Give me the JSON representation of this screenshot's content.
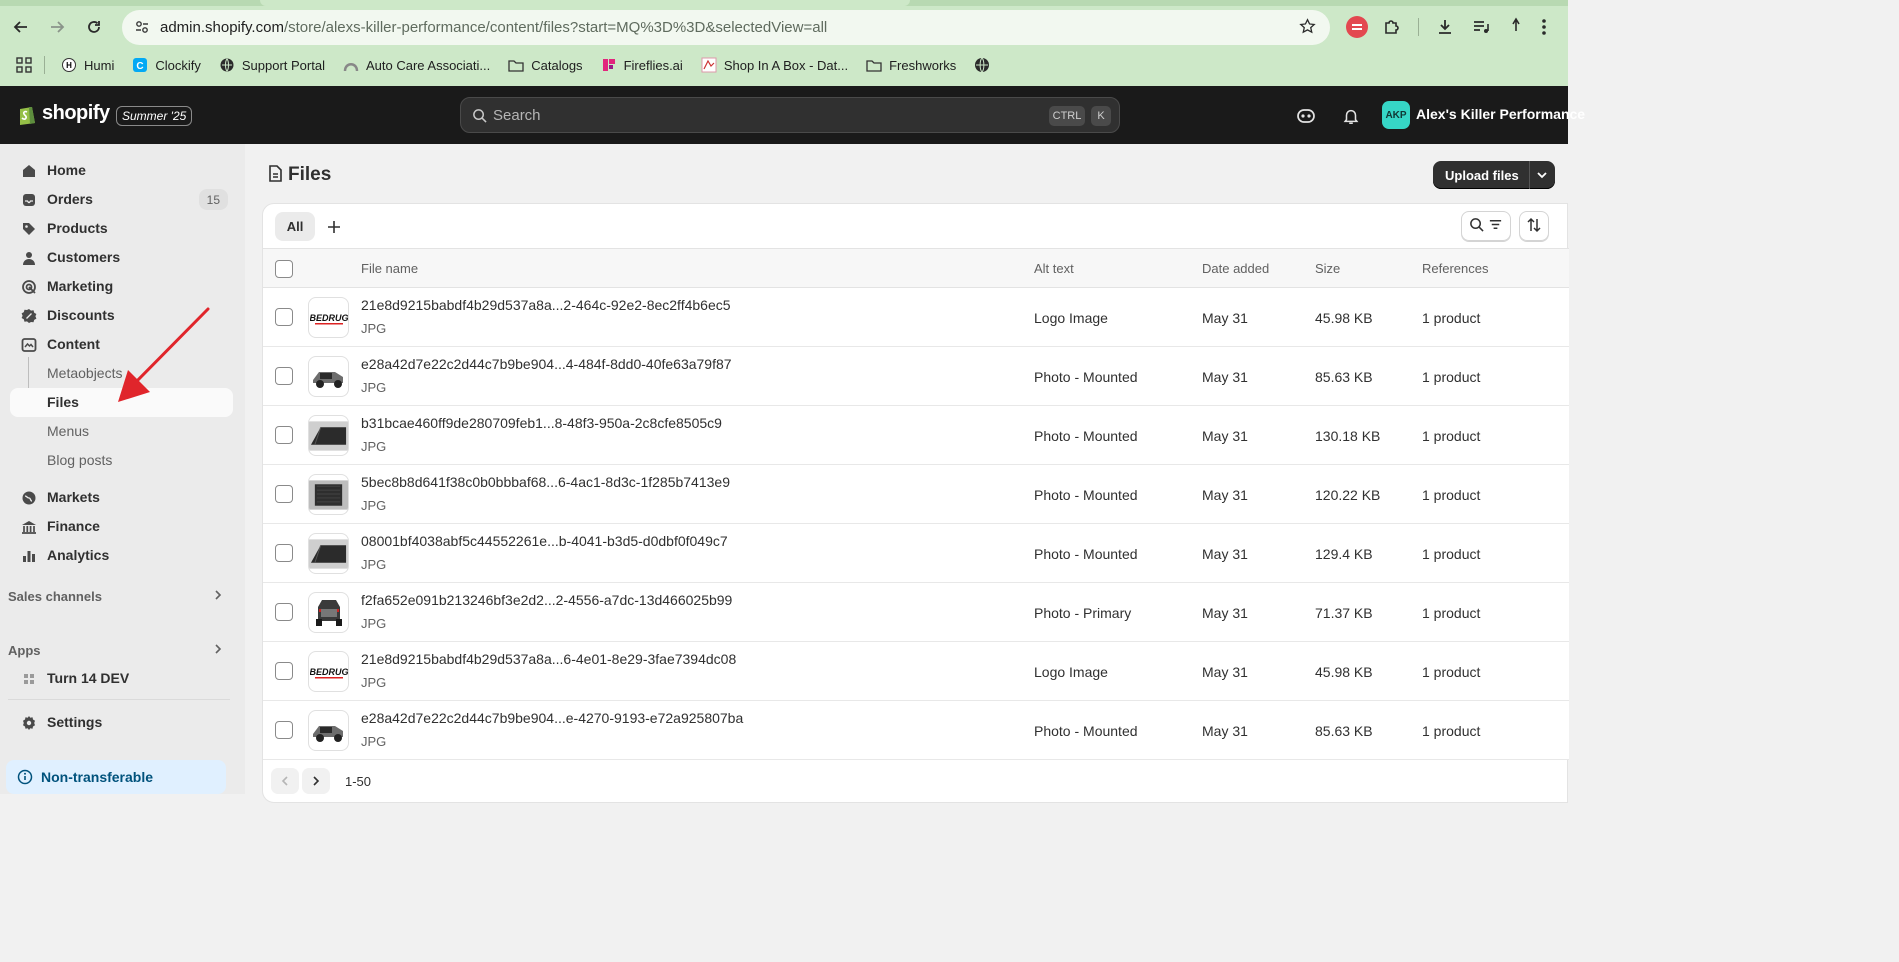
{
  "browser": {
    "url_host": "admin.shopify.com",
    "url_path": "/store/alexs-killer-performance/content/files?start=MQ%3D%3D&selectedView=all",
    "bookmarks": [
      {
        "label": "Humi",
        "icon": "humi-icon"
      },
      {
        "label": "Clockify",
        "icon": "clockify-icon"
      },
      {
        "label": "Support Portal",
        "icon": "globe-icon"
      },
      {
        "label": "Auto Care Associati...",
        "icon": "autocare-icon"
      },
      {
        "label": "Catalogs",
        "icon": "folder-icon"
      },
      {
        "label": "Fireflies.ai",
        "icon": "fireflies-icon"
      },
      {
        "label": "Shop In A Box - Dat...",
        "icon": "shopinabox-icon"
      },
      {
        "label": "Freshworks",
        "icon": "folder-icon"
      }
    ]
  },
  "topbar": {
    "brand": "shopify",
    "season_badge": "Summer '25",
    "search_placeholder": "Search",
    "kbd_ctrl": "CTRL",
    "kbd_k": "K",
    "store_initials": "AKP",
    "store_name": "Alex's Killer Performance"
  },
  "sidebar": {
    "home": "Home",
    "orders": "Orders",
    "orders_count": "15",
    "products": "Products",
    "customers": "Customers",
    "marketing": "Marketing",
    "discounts": "Discounts",
    "content": "Content",
    "metaobjects": "Metaobjects",
    "files": "Files",
    "menus": "Menus",
    "blog_posts": "Blog posts",
    "markets": "Markets",
    "finance": "Finance",
    "analytics": "Analytics",
    "sales_channels": "Sales channels",
    "apps": "Apps",
    "app_item": "Turn 14 DEV",
    "settings": "Settings",
    "non_transferable": "Non-transferable"
  },
  "main": {
    "title": "Files",
    "upload_label": "Upload files",
    "tab_all": "All",
    "columns": {
      "file_name": "File name",
      "alt_text": "Alt text",
      "date_added": "Date added",
      "size": "Size",
      "references": "References"
    },
    "rows": [
      {
        "name": "21e8d9215babdf4b29d537a8a...2-464c-92e2-8ec2ff4b6ec5",
        "type": "JPG",
        "alt": "Logo Image",
        "date": "May 31",
        "size": "45.98 KB",
        "refs": "1 product",
        "thumb": "logo"
      },
      {
        "name": "e28a42d7e22c2d44c7b9be904...4-484f-8dd0-40fe63a79f87",
        "type": "JPG",
        "alt": "Photo - Mounted",
        "date": "May 31",
        "size": "85.63 KB",
        "refs": "1 product",
        "thumb": "truck"
      },
      {
        "name": "b31bcae460ff9de280709feb1...8-48f3-950a-2c8cfe8505c9",
        "type": "JPG",
        "alt": "Photo - Mounted",
        "date": "May 31",
        "size": "130.18 KB",
        "refs": "1 product",
        "thumb": "bed-angle"
      },
      {
        "name": "5bec8b8d641f38c0b0bbbaf68...6-4ac1-8d3c-1f285b7413e9",
        "type": "JPG",
        "alt": "Photo - Mounted",
        "date": "May 31",
        "size": "120.22 KB",
        "refs": "1 product",
        "thumb": "bed-top"
      },
      {
        "name": "08001bf4038abf5c44552261e...b-4041-b3d5-d0dbf0f049c7",
        "type": "JPG",
        "alt": "Photo - Mounted",
        "date": "May 31",
        "size": "129.4 KB",
        "refs": "1 product",
        "thumb": "bed-angle"
      },
      {
        "name": "f2fa652e091b213246bf3e2d2...2-4556-a7dc-13d466025b99",
        "type": "JPG",
        "alt": "Photo - Primary",
        "date": "May 31",
        "size": "71.37 KB",
        "refs": "1 product",
        "thumb": "truck-rear"
      },
      {
        "name": "21e8d9215babdf4b29d537a8a...6-4e01-8e29-3fae7394dc08",
        "type": "JPG",
        "alt": "Logo Image",
        "date": "May 31",
        "size": "45.98 KB",
        "refs": "1 product",
        "thumb": "logo"
      },
      {
        "name": "e28a42d7e22c2d44c7b9be904...e-4270-9193-e72a925807ba",
        "type": "JPG",
        "alt": "Photo - Mounted",
        "date": "May 31",
        "size": "85.63 KB",
        "refs": "1 product",
        "thumb": "truck"
      }
    ],
    "logo_thumb_text": "BEDRUG",
    "pagination": "1-50"
  },
  "colors": {
    "chrome": "#cde8c8",
    "topbar": "#1a1a1a",
    "accent_avatar": "#36d6c6",
    "annotation_arrow": "#e0252b"
  }
}
